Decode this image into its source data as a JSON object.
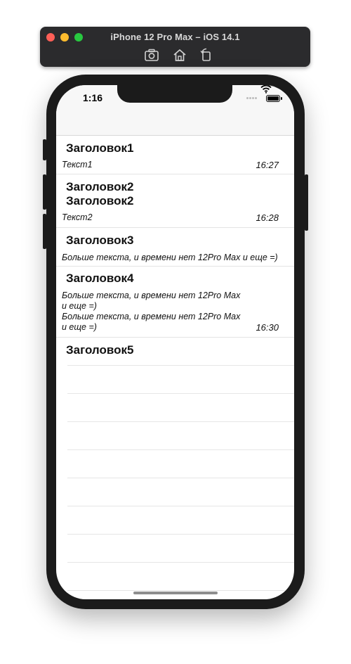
{
  "simulator": {
    "title": "iPhone 12 Pro Max – iOS 14.1",
    "tools": [
      "screenshot-icon",
      "home-icon",
      "rotate-icon"
    ]
  },
  "status_bar": {
    "time": "1:16"
  },
  "list": {
    "items": [
      {
        "title": "Заголовок1",
        "text": "Текст1",
        "time": "16:27"
      },
      {
        "title": "Заголовок2\nЗаголовок2",
        "text": "Текст2",
        "time": "16:28"
      },
      {
        "title": "Заголовок3",
        "text": "Больше текста, и времени нет 12Pro Max и еще =)",
        "time": ""
      },
      {
        "title": "Заголовок4",
        "text": "Больше текста, и времени нет 12Pro Max\nи еще =)\nБольше текста, и времени нет 12Pro Max\nи еще =)",
        "time": "16:30"
      },
      {
        "title": "Заголовок5",
        "text": "",
        "time": ""
      }
    ]
  }
}
